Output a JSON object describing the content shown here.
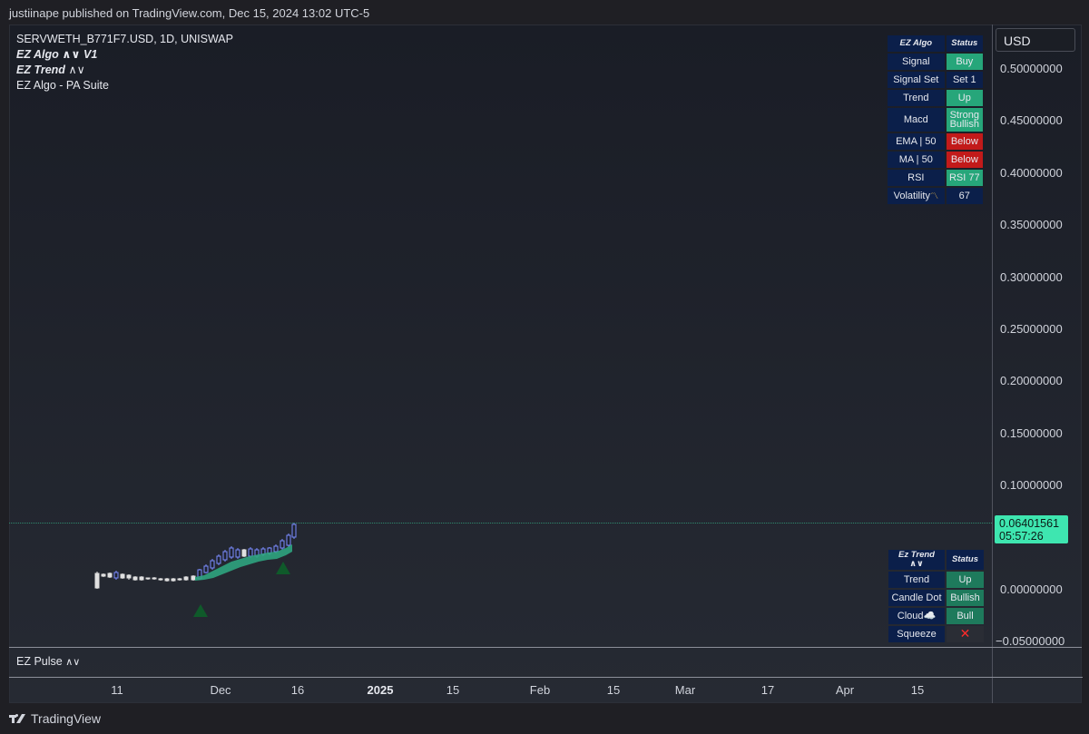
{
  "header": {
    "published_text": "justiinape published on TradingView.com, Dec 15, 2024 13:02 UTC-5"
  },
  "legend": {
    "symbol": "SERVWETH_B771F7.USD, 1D, UNISWAP",
    "indicator1": "EZ Algo",
    "indicator1_suffix": "∧∨ V1",
    "indicator2": "EZ Trend",
    "indicator2_suffix": "∧∨",
    "indicator3": "EZ Algo - PA Suite"
  },
  "price_axis": {
    "currency": "USD",
    "ticks": [
      "0.50000000",
      "0.45000000",
      "0.40000000",
      "0.35000000",
      "0.30000000",
      "0.25000000",
      "0.20000000",
      "0.15000000",
      "0.10000000",
      "0.00000000",
      "−0.05000000"
    ],
    "last_price": "0.06401561",
    "countdown": "05:57:26",
    "last_price_color": "#3ee6b0"
  },
  "time_axis": {
    "labels": [
      "11",
      "Dec",
      "16",
      "2025",
      "15",
      "Feb",
      "15",
      "Mar",
      "17",
      "Apr",
      "15"
    ]
  },
  "pulse_pane": {
    "title": "EZ Pulse",
    "suffix": "∧∨"
  },
  "footer": {
    "brand": "TradingView"
  },
  "ez_algo_table": {
    "header": [
      "EZ Algo",
      "Status"
    ],
    "rows": [
      {
        "label": "Signal",
        "value": "Buy",
        "color": "green"
      },
      {
        "label": "Signal Set",
        "value": "Set 1",
        "color": "navy"
      },
      {
        "label": "Trend",
        "value": "Up",
        "color": "green"
      },
      {
        "label": "Macd",
        "value": "Strong Bullish",
        "color": "green"
      },
      {
        "label": "EMA | 50",
        "value": "Below",
        "color": "red"
      },
      {
        "label": "MA | 50",
        "value": "Below",
        "color": "red"
      },
      {
        "label": "RSI",
        "value": "RSI 77",
        "color": "green"
      },
      {
        "label": "Volatility",
        "value": "67",
        "color": "navy"
      }
    ]
  },
  "ez_trend_table": {
    "header": [
      "Ez Trend ∧∨",
      "Status"
    ],
    "rows": [
      {
        "label": "Trend",
        "value": "Up",
        "color": "dark-green"
      },
      {
        "label": "Candle Dot",
        "value": "Bullish",
        "color": "dark-green"
      },
      {
        "label": "Cloud☁️",
        "value": "Bull",
        "color": "dark-green"
      },
      {
        "label": "Squeeze",
        "value": "✕",
        "color": "grey"
      }
    ]
  },
  "colors": {
    "up_candle": "#7b8cff",
    "down_candle": "#e0e0e0",
    "cloud": "#2fa47f",
    "signal_marker": "#0f5a2a"
  }
}
